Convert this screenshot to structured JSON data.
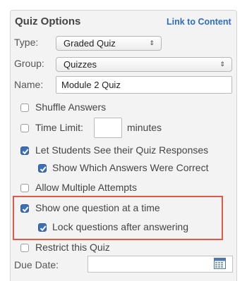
{
  "header": {
    "title": "Quiz Options",
    "link": "Link to Content"
  },
  "fields": {
    "type_label": "Type:",
    "type_value": "Graded Quiz",
    "group_label": "Group:",
    "group_value": "Quizzes",
    "name_label": "Name:",
    "name_value": "Module 2 Quiz"
  },
  "options": {
    "shuffle": {
      "label": "Shuffle Answers",
      "checked": false
    },
    "time_limit": {
      "label": "Time Limit:",
      "suffix": "minutes",
      "value": "",
      "checked": false
    },
    "see_responses": {
      "label": "Let Students See their Quiz Responses",
      "checked": true
    },
    "show_correct": {
      "label": "Show Which Answers Were Correct",
      "checked": true
    },
    "multiple_attempts": {
      "label": "Allow Multiple Attempts",
      "checked": false
    },
    "one_at_a_time": {
      "label": "Show one question at a time",
      "checked": true
    },
    "lock_questions": {
      "label": "Lock questions after answering",
      "checked": true
    },
    "restrict": {
      "label": "Restrict this Quiz",
      "checked": false
    }
  },
  "due_date": {
    "label": "Due Date:",
    "value": ""
  },
  "icons": {
    "select_arrows": "updown-arrows-icon",
    "calendar": "calendar-icon",
    "checkmark": "checkmark-icon"
  },
  "colors": {
    "link": "#2f6dbf",
    "checkbox_checked": "#3b6fb6",
    "highlight": "#e05a44"
  }
}
